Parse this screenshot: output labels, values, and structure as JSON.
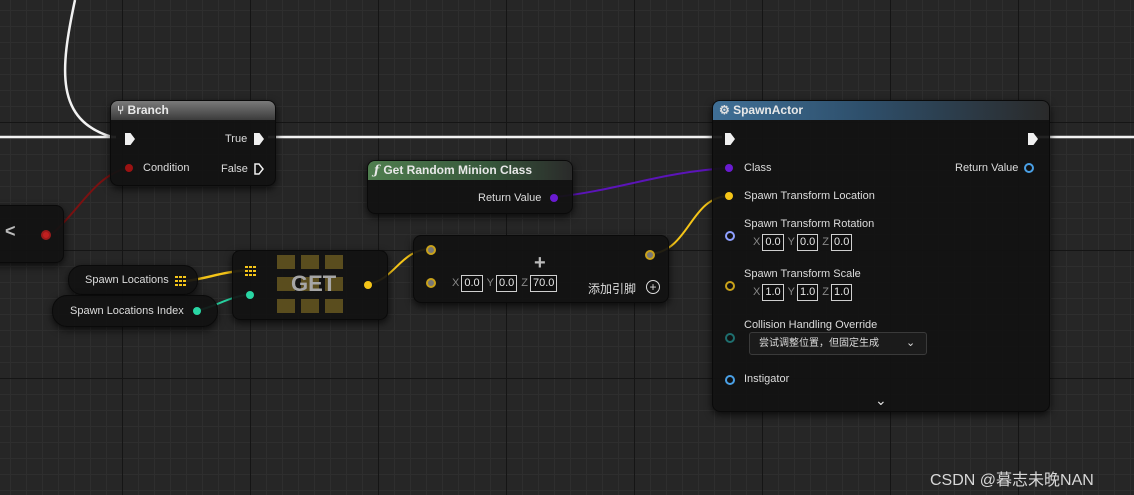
{
  "branch": {
    "title": "Branch",
    "true_label": "True",
    "false_label": "False",
    "condition_label": "Condition"
  },
  "spawn": {
    "title": "SpawnActor",
    "class_label": "Class",
    "return_label": "Return Value",
    "loc_label": "Spawn Transform Location",
    "rot_label": "Spawn Transform Rotation",
    "rot": {
      "x": "0.0",
      "y": "0.0",
      "z": "0.0"
    },
    "scale_label": "Spawn Transform Scale",
    "scale": {
      "x": "1.0",
      "y": "1.0",
      "z": "1.0"
    },
    "collision_label": "Collision Handling Override",
    "collision_value": "尝试调整位置，但固定生成",
    "instigator_label": "Instigator"
  },
  "random": {
    "title": "Get Random Minion Class",
    "return_label": "Return Value"
  },
  "compare": {
    "symbol": "<"
  },
  "vars": {
    "spawn_locations": "Spawn Locations",
    "spawn_locations_index": "Spawn Locations Index"
  },
  "get": {
    "label": "GET"
  },
  "add": {
    "x": "0.0",
    "y": "0.0",
    "z": "70.0",
    "add_pin_label": "添加引脚",
    "plus": "+"
  },
  "axes": {
    "x": "X",
    "y": "Y",
    "z": "Z"
  },
  "watermark": "CSDN @暮志未晚NAN",
  "colors": {
    "exec": "#f0f0f0",
    "vector": "#f5c518",
    "object": "#5b9bd5",
    "class": "#6a1bd1",
    "bool": "#8a0f0f",
    "int": "#29d6a4",
    "struct": "#1e6f6f"
  }
}
